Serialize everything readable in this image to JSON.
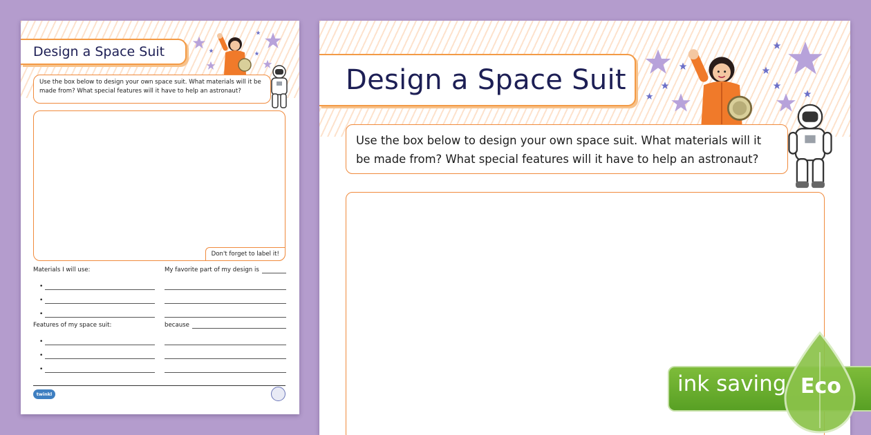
{
  "worksheet": {
    "title": "Design a Space Suit",
    "instructions": "Use the box below to design your own space suit. What materials will it be made from? What special features will it have to help an astronaut?",
    "label_reminder": "Don't forget to label it!",
    "materials_heading": "Materials I will use:",
    "favorite_heading": "My favorite part of my design is",
    "features_heading": "Features of my space suit:",
    "because_heading": "because",
    "bullet": "•",
    "logo_text": "twinkl"
  },
  "eco_badge": {
    "label": "ink saving",
    "eco_word": "Eco"
  },
  "colors": {
    "background": "#b49ccd",
    "accent_orange": "#f08a3c",
    "title_navy": "#1d1f55",
    "star_lilac": "#b7a2da",
    "star_blue": "#6b6fc8",
    "eco_green": "#6aae2f"
  }
}
